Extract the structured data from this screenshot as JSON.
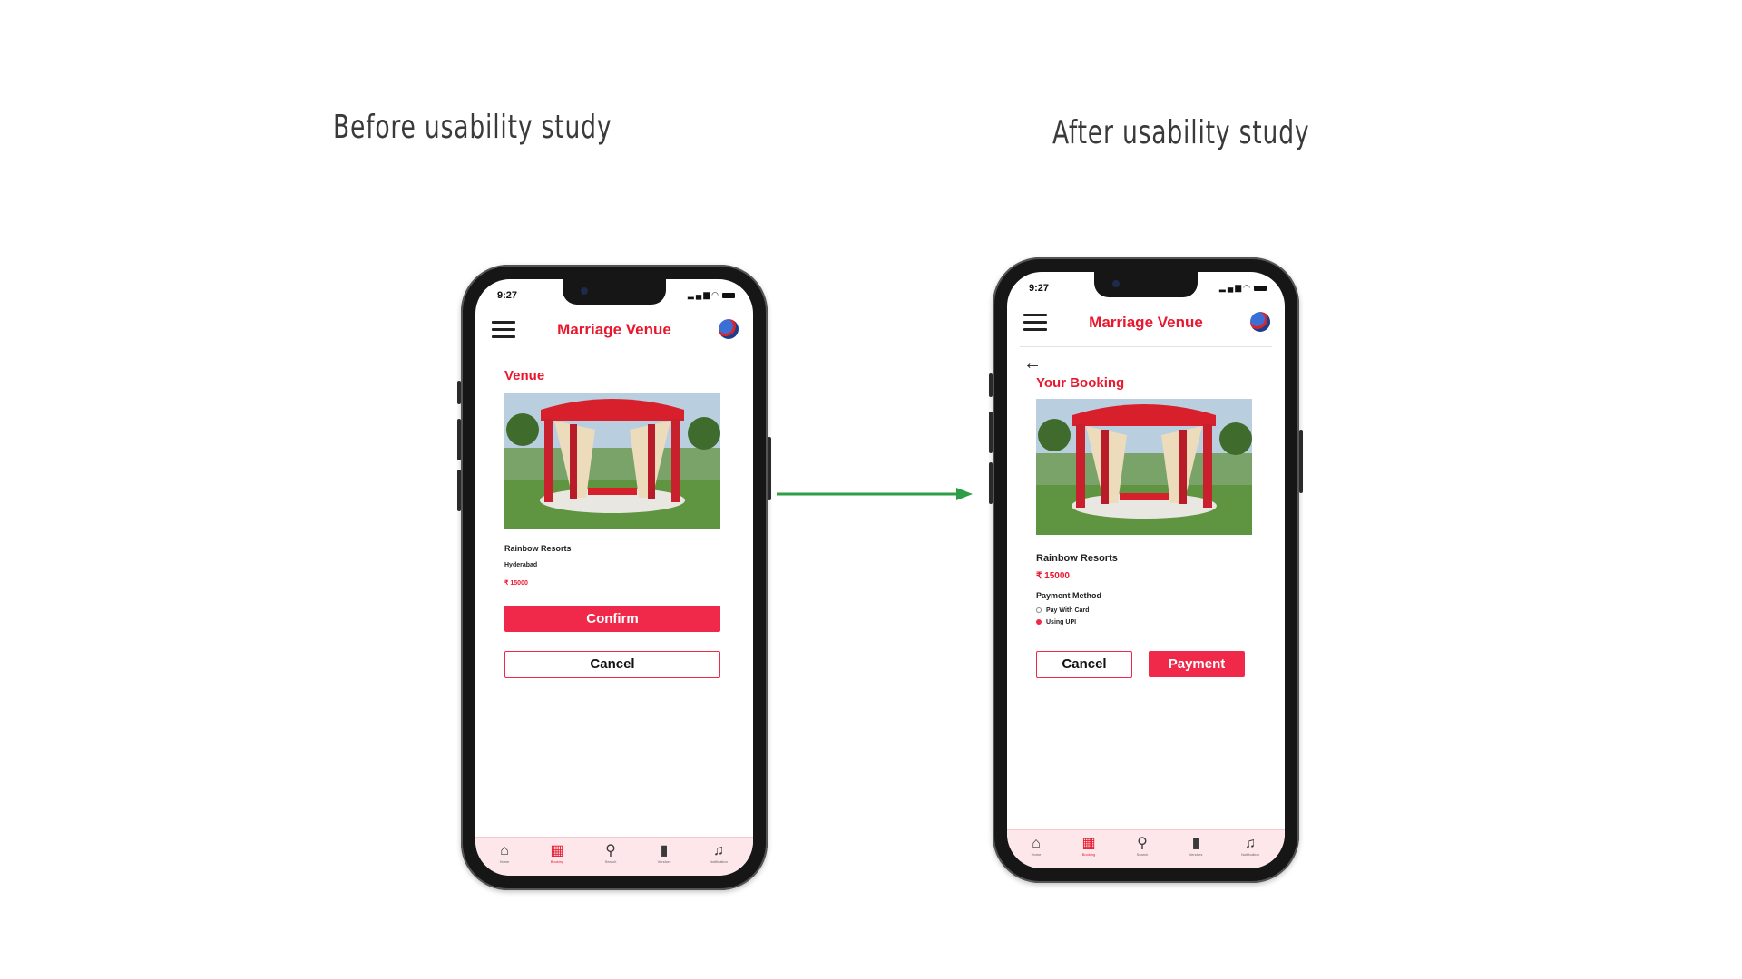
{
  "headings": {
    "before": "Before usability study",
    "after": "After usability study"
  },
  "phone_before": {
    "status_time": "9:27",
    "app_title": "Marriage Venue",
    "section_title": "Venue",
    "venue_name": "Rainbow Resorts",
    "location": "Hyderabad",
    "price": "₹ 15000",
    "confirm_label": "Confirm",
    "cancel_label": "Cancel"
  },
  "phone_after": {
    "status_time": "9:27",
    "app_title": "Marriage Venue",
    "section_title": "Your Booking",
    "venue_name": "Rainbow Resorts",
    "price": "₹ 15000",
    "payment_method_label": "Payment Method",
    "payment_options": [
      "Pay With Card",
      "Using UPI"
    ],
    "selected_payment": "Using UPI",
    "cancel_label": "Cancel",
    "payment_label": "Payment"
  },
  "bottom_nav": [
    {
      "label": "Home",
      "icon": "home-icon",
      "active": false
    },
    {
      "label": "Booking",
      "icon": "calendar-icon",
      "active": true
    },
    {
      "label": "Search",
      "icon": "search-icon",
      "active": false
    },
    {
      "label": "Vendors",
      "icon": "bookmark-icon",
      "active": false
    },
    {
      "label": "Notification",
      "icon": "bell-icon",
      "active": false
    }
  ],
  "colors": {
    "accent": "#e8192f",
    "button": "#f0294a",
    "arrow": "#2e9e46",
    "nav_background": "#fde7ea"
  }
}
